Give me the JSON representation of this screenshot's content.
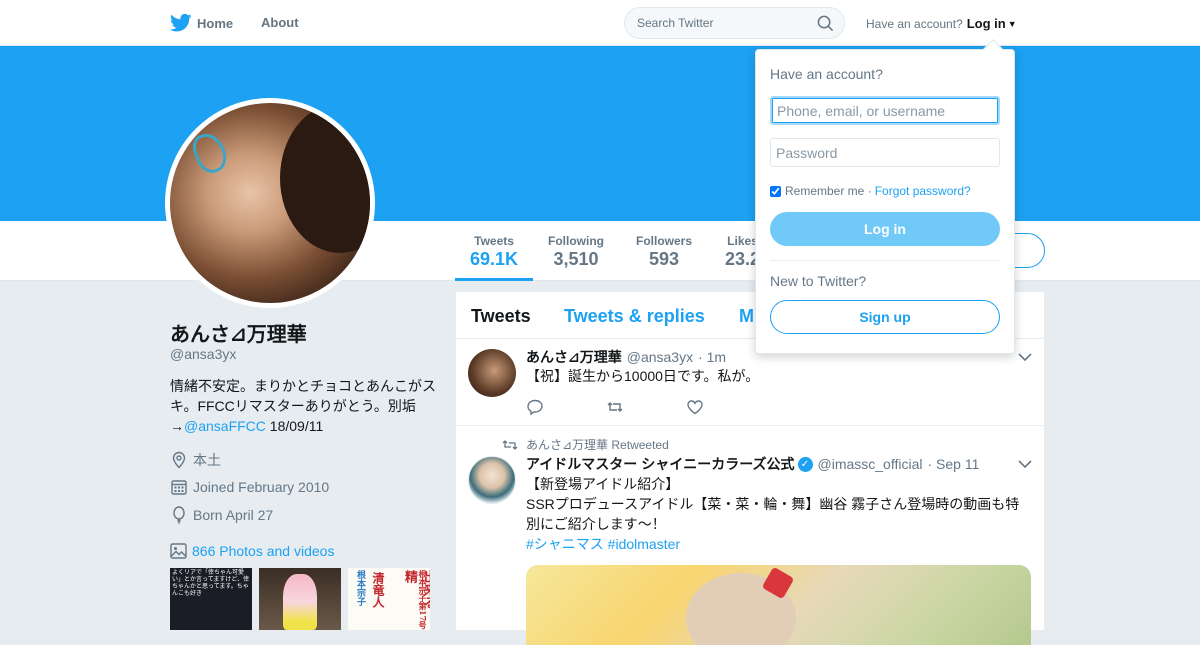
{
  "nav": {
    "home_label": "Home",
    "about_label": "About",
    "search_placeholder": "Search Twitter",
    "have_account": "Have an account?",
    "login_label": "Log in"
  },
  "profile": {
    "name": "あんさ⊿万理華",
    "handle": "@ansa3yx",
    "bio_text": "情緒不安定。まりかとチョコとあんこがスキ。FFCCリマスターありがとう。別垢→",
    "bio_link": "@ansaFFCC",
    "bio_suffix": " 18/09/11",
    "location": "本土",
    "joined": "Joined February 2010",
    "born": "Born April 27",
    "photos_link": "866 Photos and videos",
    "header_color": "#1da1f2"
  },
  "stats": [
    {
      "label": "Tweets",
      "value": "69.1K"
    },
    {
      "label": "Following",
      "value": "3,510"
    },
    {
      "label": "Followers",
      "value": "593"
    },
    {
      "label": "Likes",
      "value": "23.2"
    }
  ],
  "thumbs": {
    "thumb1_text": "よくリアで「倖ちゃん可愛い」とか言ってますけど、倖ちゃんかと思ってます。ちゃんこも好き",
    "thumb3_a": "根本宗子",
    "thumb3_b": "清竜人",
    "thumb3_c": "出来る、精",
    "thumb3_d": "根本宗子第17号"
  },
  "timeline": {
    "tabs": [
      "Tweets",
      "Tweets & replies",
      "M"
    ],
    "tweets": [
      {
        "name": "あんさ⊿万理華",
        "handle": "@ansa3yx",
        "time": "· 1m",
        "text": "【祝】誕生から10000日です。私が。"
      },
      {
        "retweeted_by": "あんさ⊿万理華 Retweeted",
        "name": "アイドルマスター シャイニーカラーズ公式",
        "handle": "@imassc_official",
        "time": "· Sep 11",
        "text_1": "【新登場アイドル紹介】",
        "text_2": "SSRプロデュースアイドル【菜・菜・輪・舞】幽谷 霧子さん登場時の動画も特別にご紹介します～！",
        "hashtags": "#シャニマス #idolmaster"
      }
    ]
  },
  "login_dropdown": {
    "title": "Have an account?",
    "username_placeholder": "Phone, email, or username",
    "password_placeholder": "Password",
    "remember_label": "Remember me ·",
    "forgot_label": "Forgot password?",
    "login_button": "Log in",
    "new_to": "New to Twitter?",
    "signup_button": "Sign up"
  },
  "colors": {
    "accent": "#1da1f2",
    "login_button": "#71c9f8"
  }
}
